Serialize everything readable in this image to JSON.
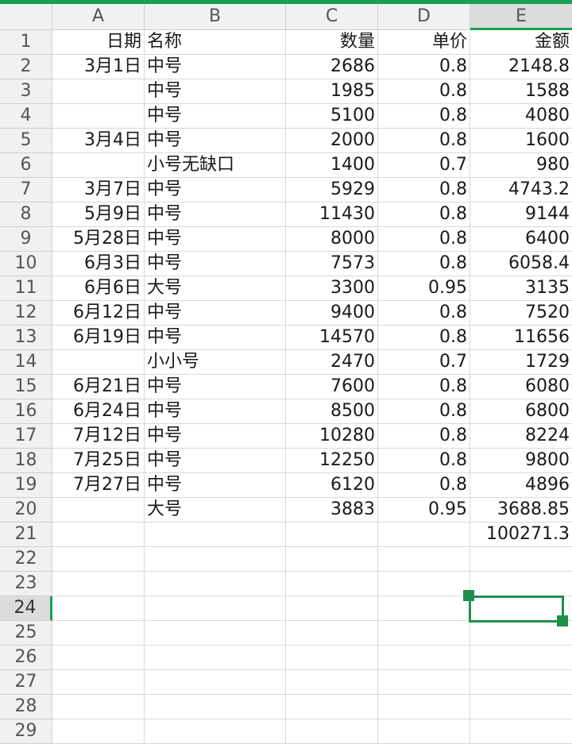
{
  "columns": [
    "A",
    "B",
    "C",
    "D",
    "E"
  ],
  "rows": [
    {
      "n": "1",
      "a": "日期",
      "b": "名称",
      "c": "数量",
      "d": "单价",
      "e": "金额"
    },
    {
      "n": "2",
      "a": "3月1日",
      "b": "中号",
      "c": "2686",
      "d": "0.8",
      "e": "2148.8"
    },
    {
      "n": "3",
      "a": "",
      "b": "中号",
      "c": "1985",
      "d": "0.8",
      "e": "1588"
    },
    {
      "n": "4",
      "a": "",
      "b": "中号",
      "c": "5100",
      "d": "0.8",
      "e": "4080"
    },
    {
      "n": "5",
      "a": "3月4日",
      "b": "中号",
      "c": "2000",
      "d": "0.8",
      "e": "1600"
    },
    {
      "n": "6",
      "a": "",
      "b": "小号无缺口",
      "c": "1400",
      "d": "0.7",
      "e": "980"
    },
    {
      "n": "7",
      "a": "3月7日",
      "b": "中号",
      "c": "5929",
      "d": "0.8",
      "e": "4743.2"
    },
    {
      "n": "8",
      "a": "5月9日",
      "b": "中号",
      "c": "11430",
      "d": "0.8",
      "e": "9144"
    },
    {
      "n": "9",
      "a": "5月28日",
      "b": "中号",
      "c": "8000",
      "d": "0.8",
      "e": "6400"
    },
    {
      "n": "10",
      "a": "6月3日",
      "b": "中号",
      "c": "7573",
      "d": "0.8",
      "e": "6058.4"
    },
    {
      "n": "11",
      "a": "6月6日",
      "b": "大号",
      "c": "3300",
      "d": "0.95",
      "e": "3135"
    },
    {
      "n": "12",
      "a": "6月12日",
      "b": "中号",
      "c": "9400",
      "d": "0.8",
      "e": "7520"
    },
    {
      "n": "13",
      "a": "6月19日",
      "b": "中号",
      "c": "14570",
      "d": "0.8",
      "e": "11656"
    },
    {
      "n": "14",
      "a": "",
      "b": "小小号",
      "c": "2470",
      "d": "0.7",
      "e": "1729"
    },
    {
      "n": "15",
      "a": "6月21日",
      "b": "中号",
      "c": "7600",
      "d": "0.8",
      "e": "6080"
    },
    {
      "n": "16",
      "a": "6月24日",
      "b": "中号",
      "c": "8500",
      "d": "0.8",
      "e": "6800"
    },
    {
      "n": "17",
      "a": "7月12日",
      "b": "中号",
      "c": "10280",
      "d": "0.8",
      "e": "8224"
    },
    {
      "n": "18",
      "a": "7月25日",
      "b": "中号",
      "c": "12250",
      "d": "0.8",
      "e": "9800"
    },
    {
      "n": "19",
      "a": "7月27日",
      "b": "中号",
      "c": "6120",
      "d": "0.8",
      "e": "4896"
    },
    {
      "n": "20",
      "a": "",
      "b": "大号",
      "c": "3883",
      "d": "0.95",
      "e": "3688.85"
    },
    {
      "n": "21",
      "a": "",
      "b": "",
      "c": "",
      "d": "",
      "e": "100271.3"
    },
    {
      "n": "22",
      "a": "",
      "b": "",
      "c": "",
      "d": "",
      "e": ""
    },
    {
      "n": "23",
      "a": "",
      "b": "",
      "c": "",
      "d": "",
      "e": ""
    },
    {
      "n": "24",
      "a": "",
      "b": "",
      "c": "",
      "d": "",
      "e": ""
    },
    {
      "n": "25",
      "a": "",
      "b": "",
      "c": "",
      "d": "",
      "e": ""
    },
    {
      "n": "26",
      "a": "",
      "b": "",
      "c": "",
      "d": "",
      "e": ""
    },
    {
      "n": "27",
      "a": "",
      "b": "",
      "c": "",
      "d": "",
      "e": ""
    },
    {
      "n": "28",
      "a": "",
      "b": "",
      "c": "",
      "d": "",
      "e": ""
    },
    {
      "n": "29",
      "a": "",
      "b": "",
      "c": "",
      "d": "",
      "e": ""
    }
  ],
  "selection": {
    "cell": "E24",
    "active_row": "24",
    "active_column": "E"
  },
  "colors": {
    "accent": "#1a9e55",
    "header_bg": "#f1f1f1",
    "gridline": "#d9d9d9"
  }
}
